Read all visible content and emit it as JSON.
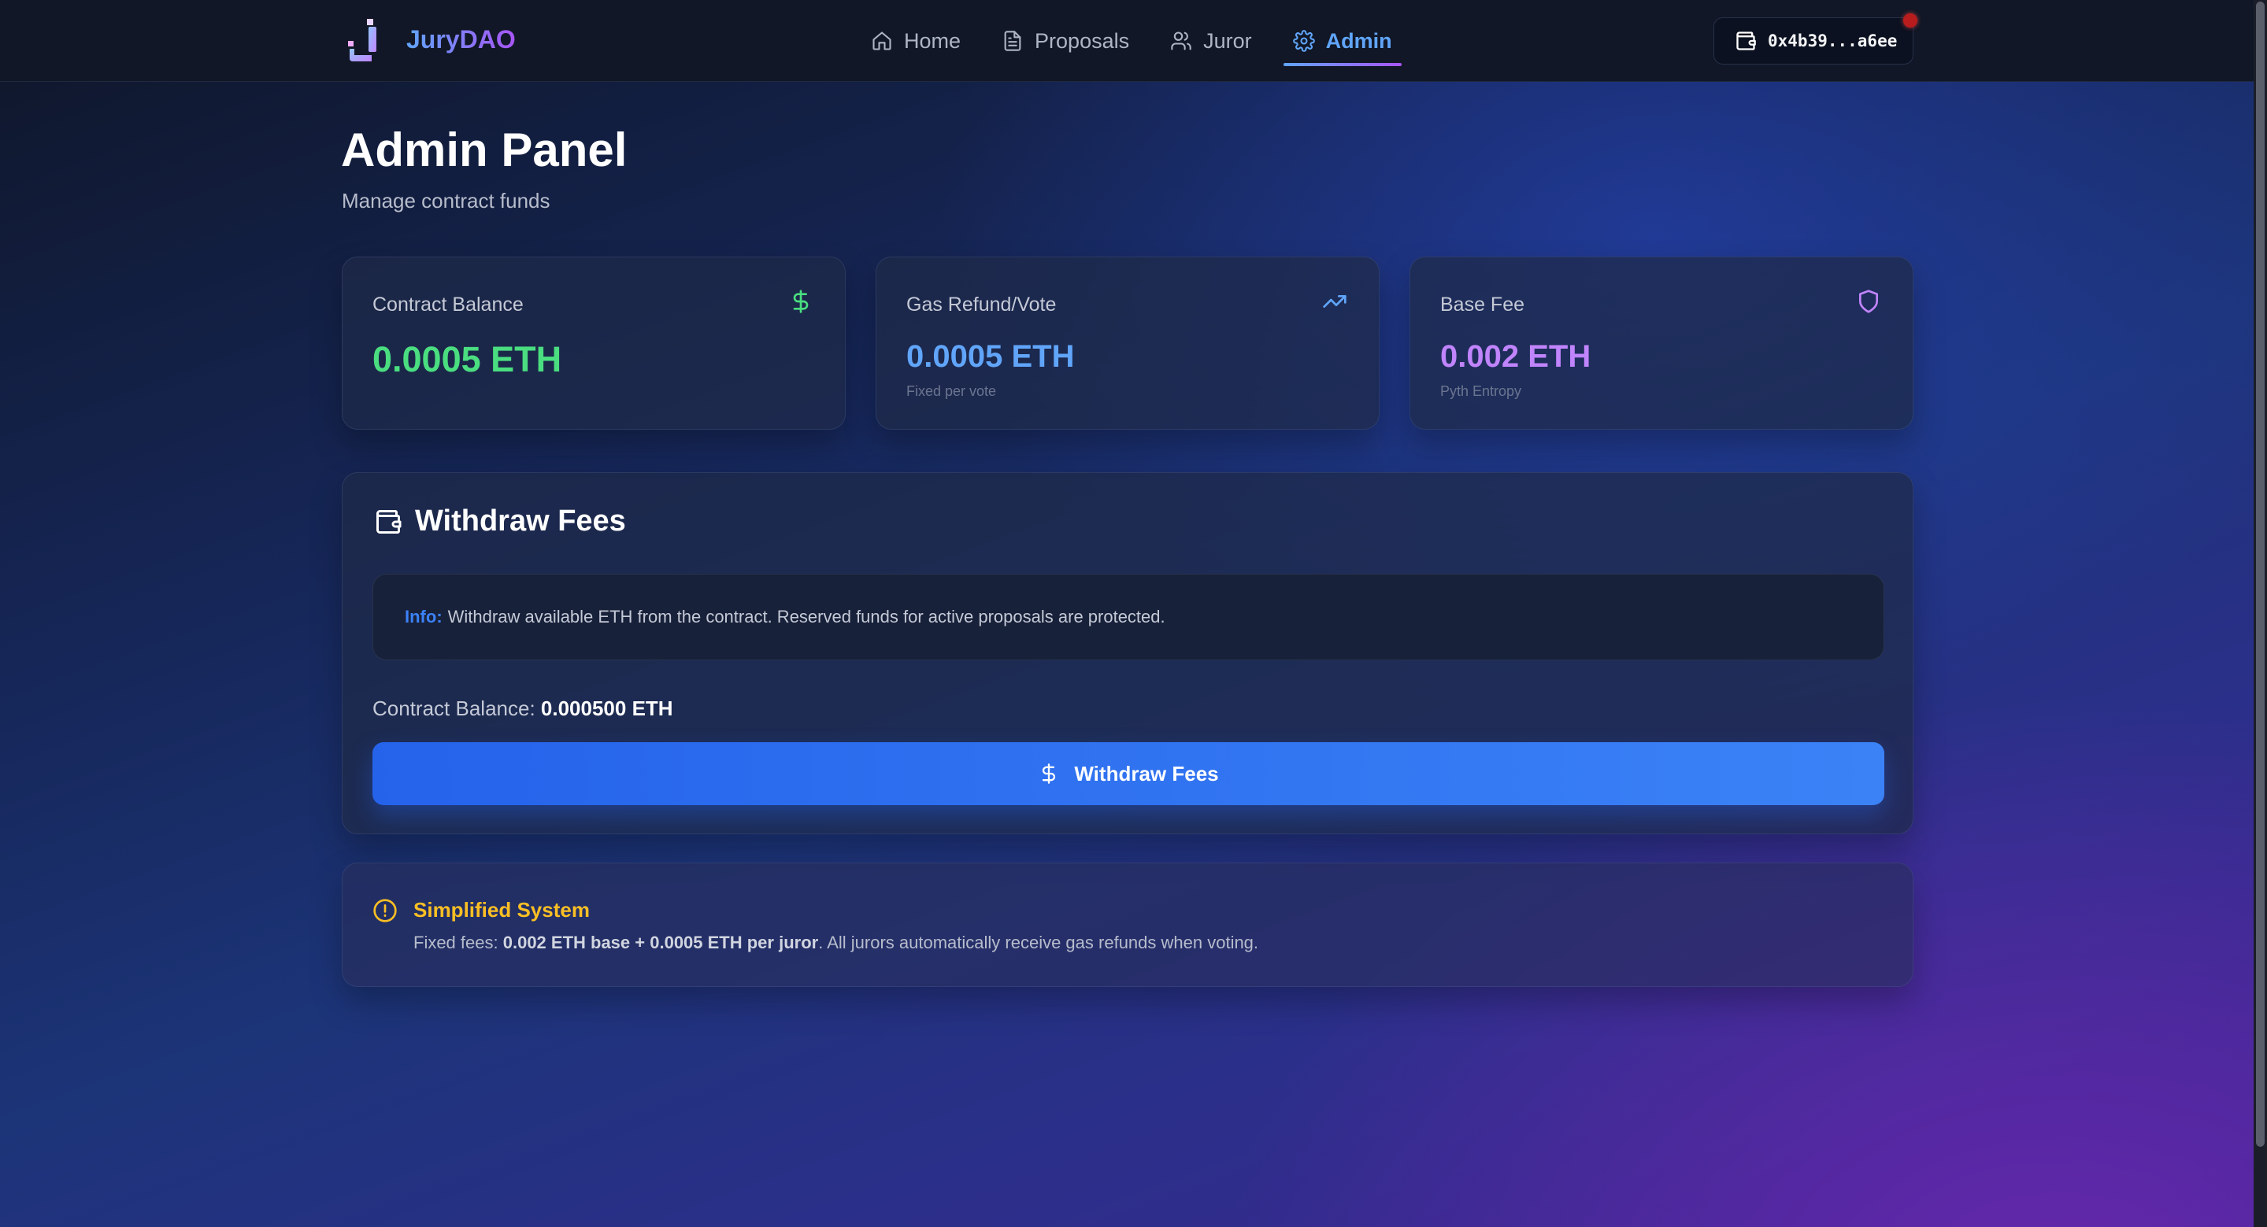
{
  "app": {
    "brand": "JuryDAO"
  },
  "nav": {
    "items": [
      {
        "label": "Home",
        "icon": "home-icon"
      },
      {
        "label": "Proposals",
        "icon": "document-icon"
      },
      {
        "label": "Juror",
        "icon": "users-icon"
      },
      {
        "label": "Admin",
        "icon": "gear-icon",
        "active": true
      }
    ],
    "wallet_address": "0x4b39...a6ee"
  },
  "header": {
    "title": "Admin Panel",
    "subtitle": "Manage contract funds"
  },
  "stats": [
    {
      "label": "Contract Balance",
      "value": "0.0005 ETH",
      "note": "",
      "icon": "dollar-icon",
      "color": "#4ade80"
    },
    {
      "label": "Gas Refund/Vote",
      "value": "0.0005 ETH",
      "note": "Fixed per vote",
      "icon": "trending-up-icon",
      "color": "#60a5fa"
    },
    {
      "label": "Base Fee",
      "value": "0.002 ETH",
      "note": "Pyth Entropy",
      "icon": "shield-icon",
      "color": "#c084fc"
    }
  ],
  "withdraw": {
    "title": "Withdraw Fees",
    "info_label": "Info:",
    "info_text": "Withdraw available ETH from the contract. Reserved funds for active proposals are protected.",
    "balance_label": "Contract Balance:",
    "balance_value": "0.000500 ETH",
    "button_label": "Withdraw Fees"
  },
  "notice": {
    "title": "Simplified System",
    "text_prefix": "Fixed fees:",
    "text_bold": "0.002 ETH base + 0.0005 ETH per juror",
    "text_suffix": ". All jurors automatically receive gas refunds when voting."
  },
  "colors": {
    "accent": "#3b82f6",
    "warning": "#fbbf24",
    "success": "#4ade80",
    "purple": "#c084fc"
  }
}
